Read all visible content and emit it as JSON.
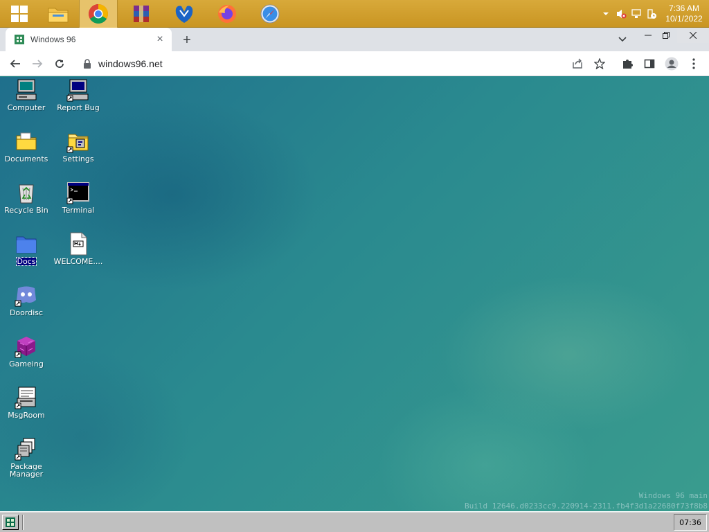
{
  "host_taskbar": {
    "apps": [
      {
        "name": "start-windows-icon"
      },
      {
        "name": "file-explorer-icon"
      },
      {
        "name": "chrome-icon",
        "active": true
      },
      {
        "name": "winrar-icon"
      },
      {
        "name": "malwarebytes-icon"
      },
      {
        "name": "firefox-icon"
      },
      {
        "name": "safari-icon"
      }
    ],
    "clock": {
      "time": "7:36 AM",
      "date": "10/1/2022"
    }
  },
  "browser": {
    "tab_title": "Windows 96",
    "new_tab_label": "+",
    "url": "windows96.net",
    "tab_close_label": "×"
  },
  "desktop": {
    "icons": [
      {
        "label": "Computer",
        "icon": "computer-icon",
        "selected": false
      },
      {
        "label": "Report Bug",
        "icon": "report-bug-icon",
        "selected": false
      },
      {
        "label": "Documents",
        "icon": "documents-folder-icon",
        "selected": false
      },
      {
        "label": "Settings",
        "icon": "settings-folder-icon",
        "selected": false
      },
      {
        "label": "Recycle Bin",
        "icon": "recycle-bin-icon",
        "selected": false
      },
      {
        "label": "Terminal",
        "icon": "terminal-icon",
        "selected": false
      },
      {
        "label": "Docs",
        "icon": "blue-folder-icon",
        "selected": true
      },
      {
        "label": "WELCOME....",
        "icon": "markdown-file-icon",
        "selected": false
      },
      {
        "label": "Doordisc",
        "icon": "doordisc-icon",
        "selected": false
      },
      {
        "label": "Gameing",
        "icon": "gameing-cube-icon",
        "selected": false
      },
      {
        "label": "MsgRoom",
        "icon": "msgroom-icon",
        "selected": false
      },
      {
        "label": "Package Manager",
        "icon": "package-manager-icon",
        "selected": false
      }
    ],
    "build_line1": "Windows 96 main",
    "build_line2": "Build 12646.d0233cc9.220914-2311.fb4f3d1a22680f73f8b8"
  },
  "w96_taskbar": {
    "clock": "07:36"
  },
  "colors": {
    "host_taskbar": "#c99522",
    "desktop_teal": "#2a8a8f",
    "selection_blue": "#000080",
    "win96_gray": "#c0c0c0"
  }
}
